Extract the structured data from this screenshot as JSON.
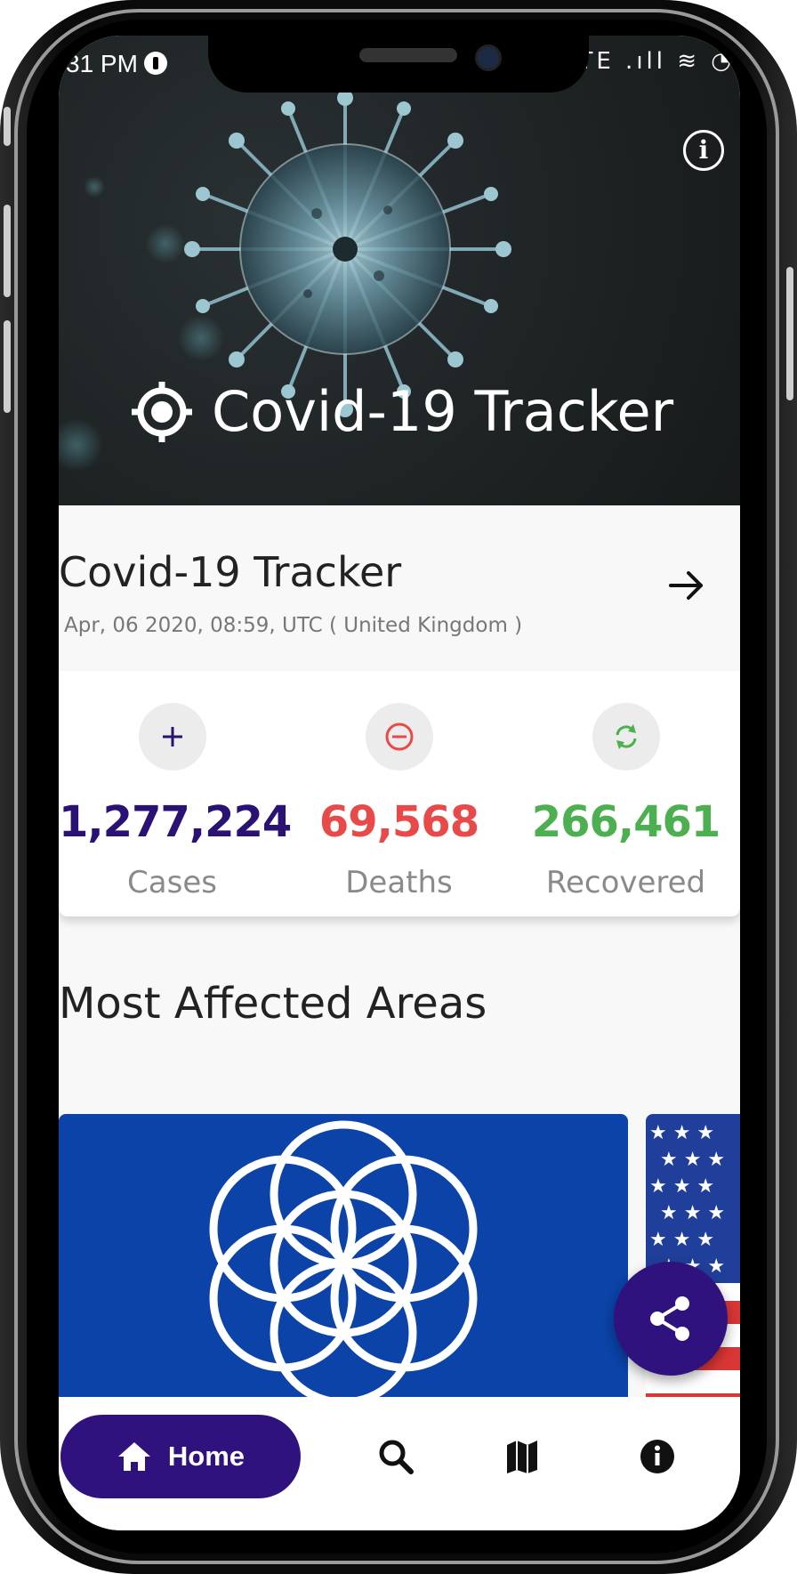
{
  "status_bar": {
    "time": "31 PM",
    "indicators": "LTE .ıll ≋ ◔"
  },
  "hero": {
    "title": "Covid-19 Tracker",
    "info_icon": "info-circle-icon",
    "location_icon": "crosshair-target-icon"
  },
  "update": {
    "title": "Covid-19 Tracker",
    "date": "Apr, 06 2020, 08:59, UTC ( United Kingdom )",
    "arrow_icon": "arrow-right-icon"
  },
  "stats": [
    {
      "icon": "plus-icon",
      "value": "1,277,224",
      "label": "Cases",
      "color": "#2a1275"
    },
    {
      "icon": "minus-circle-icon",
      "value": "69,568",
      "label": "Deaths",
      "color": "#e84a4a"
    },
    {
      "icon": "refresh-icon",
      "value": "266,461",
      "label": "Recovered",
      "color": "#4caf50"
    }
  ],
  "section": {
    "title": "Most Affected Areas"
  },
  "areas": [
    {
      "flag": "world-flag"
    },
    {
      "flag": "usa-flag"
    }
  ],
  "fab": {
    "icon": "share-icon"
  },
  "nav": {
    "home_label": "Home",
    "items": [
      "home-icon",
      "search-icon",
      "map-icon",
      "info-icon"
    ]
  },
  "colors": {
    "primary": "#30127f",
    "hero_bg": "#1d2223",
    "flag_blue": "#0b43a8"
  }
}
